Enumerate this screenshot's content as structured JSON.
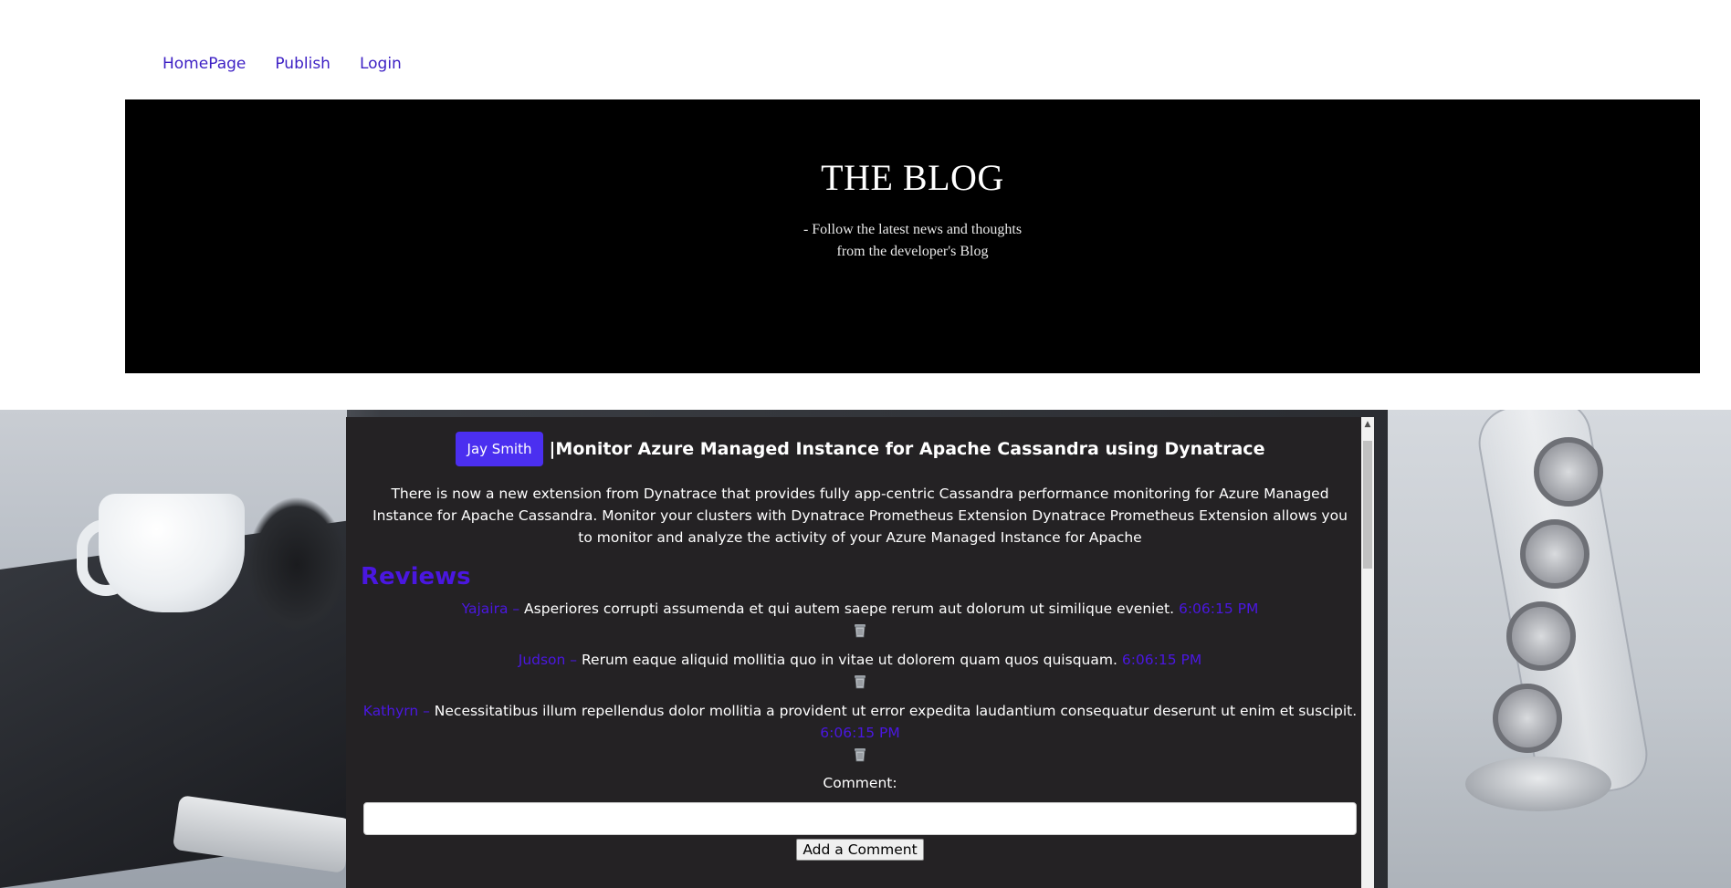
{
  "nav": {
    "items": [
      {
        "label": "HomePage"
      },
      {
        "label": "Publish"
      },
      {
        "label": "Login"
      }
    ]
  },
  "hero": {
    "title": "THE BLOG",
    "tagline": "- Follow the latest news and thoughts from the developer's Blog"
  },
  "post": {
    "author": "Jay Smith",
    "title": "|Monitor Azure Managed Instance for Apache Cassandra using Dynatrace",
    "body": "There is now a new extension from Dynatrace that provides fully app-centric Cassandra performance monitoring for Azure Managed Instance for Apache Cassandra. Monitor your clusters with Dynatrace Prometheus Extension Dynatrace Prometheus Extension allows you to monitor and analyze the activity of your Azure Managed Instance for Apache"
  },
  "reviews": {
    "heading": "Reviews",
    "items": [
      {
        "name": "Yajaira – ",
        "text": "Asperiores corrupti assumenda et qui autem saepe rerum aut dolorum ut similique eveniet.",
        "time": "6:06:15 PM"
      },
      {
        "name": "Judson – ",
        "text": "Rerum eaque aliquid mollitia quo in vitae ut dolorem quam quos quisquam.",
        "time": "6:06:15 PM"
      },
      {
        "name": "Kathyrn – ",
        "text": "Necessitatibus illum repellendus dolor mollitia a provident ut error expedita laudantium consequatur deserunt ut enim et suscipit.",
        "time": "6:06:15 PM"
      }
    ]
  },
  "comment_form": {
    "label": "Comment:",
    "input_value": "",
    "submit_label": "Add a Comment"
  },
  "colors": {
    "accent": "#4b2ff0",
    "review_meta": "#4a17e0",
    "panel_bg": "#242224",
    "hero_bg": "#000000",
    "nav_link": "#3c1fc4"
  },
  "icons": {
    "delete": "trash-icon",
    "scroll_up": "arrow-up-icon"
  }
}
